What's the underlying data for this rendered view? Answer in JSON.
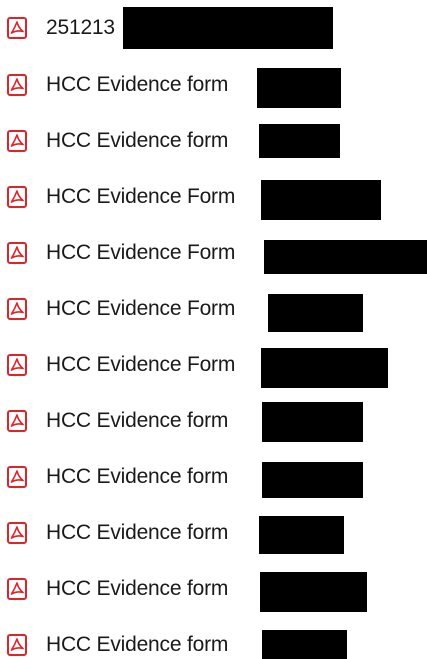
{
  "file_list": {
    "items": [
      {
        "name": "251213",
        "icon": "pdf-file-icon"
      },
      {
        "name": "HCC Evidence form",
        "icon": "pdf-file-icon"
      },
      {
        "name": "HCC Evidence form",
        "icon": "pdf-file-icon"
      },
      {
        "name": "HCC Evidence Form",
        "icon": "pdf-file-icon"
      },
      {
        "name": "HCC Evidence Form",
        "icon": "pdf-file-icon"
      },
      {
        "name": "HCC Evidence Form",
        "icon": "pdf-file-icon"
      },
      {
        "name": "HCC Evidence Form",
        "icon": "pdf-file-icon"
      },
      {
        "name": "HCC Evidence form",
        "icon": "pdf-file-icon"
      },
      {
        "name": "HCC Evidence form",
        "icon": "pdf-file-icon"
      },
      {
        "name": "HCC Evidence form",
        "icon": "pdf-file-icon"
      },
      {
        "name": "HCC Evidence form",
        "icon": "pdf-file-icon"
      },
      {
        "name": "HCC Evidence form",
        "icon": "pdf-file-icon"
      }
    ]
  },
  "colors": {
    "pdf_icon_red": "#d9262b",
    "text": "#1a1a1a",
    "redaction": "#000000"
  }
}
